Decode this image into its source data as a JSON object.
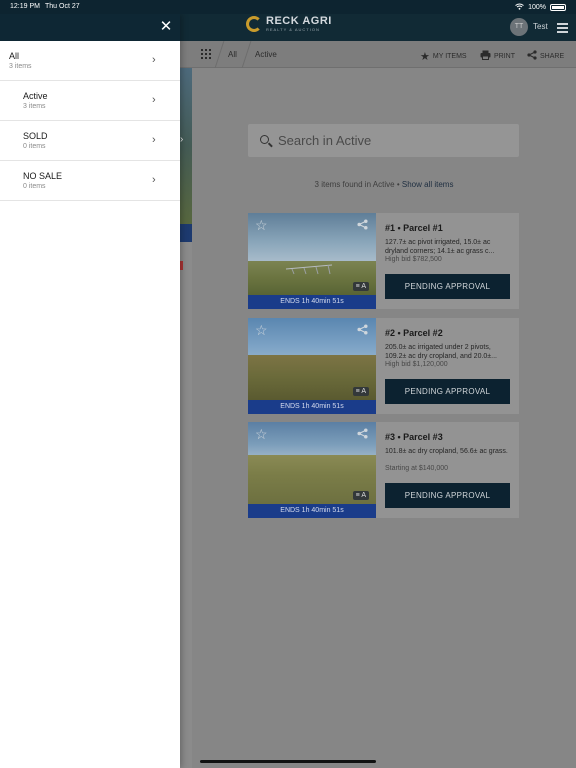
{
  "status_bar": {
    "time": "12:19 PM",
    "date": "Thu Oct 27",
    "battery": "100%"
  },
  "header": {
    "logo_name": "RECK AGRI",
    "logo_sub": "REALTY & AUCTION",
    "avatar_initials": "TT",
    "username": "Test"
  },
  "toolbar": {
    "breadcrumbs": [
      "All",
      "Active"
    ],
    "my_items": "MY ITEMS",
    "print": "PRINT",
    "share": "SHARE"
  },
  "search": {
    "placeholder": "Search in Active"
  },
  "results": {
    "summary": "3 items found in Active",
    "separator": "•",
    "show_all": "Show all items"
  },
  "lots": [
    {
      "title": "#1 • Parcel #1",
      "description": "127.7± ac pivot irrigated, 15.0± ac dryland corners; 14.1± ac grass c...",
      "bid": "High bid $782,500",
      "ends": "ENDS 1h 40min 51s",
      "badge": "A",
      "action": "PENDING APPROVAL"
    },
    {
      "title": "#2 • Parcel #2",
      "description": "205.0± ac irrigated under 2 pivots, 109.2± ac dry cropland, and 20.0±...",
      "bid": "High bid $1,120,000",
      "ends": "ENDS 1h 40min 51s",
      "badge": "A",
      "action": "PENDING APPROVAL"
    },
    {
      "title": "#3 • Parcel #3",
      "description": "101.8± ac dry cropland, 56.6± ac grass.",
      "bid": "Starting at $140,000",
      "ends": "ENDS 1h 40min 51s",
      "badge": "A",
      "action": "PENDING APPROVAL"
    }
  ],
  "drawer": {
    "items": [
      {
        "label": "All",
        "count": "3 items"
      },
      {
        "label": "Active",
        "count": "3 items"
      },
      {
        "label": "SOLD",
        "count": "0 items"
      },
      {
        "label": "NO SALE",
        "count": "0 items"
      }
    ]
  },
  "colors": {
    "header": "#112a35",
    "ends_bar": "#1a3c8a",
    "action": "#0c2230",
    "logo_accent": "#c89b2c"
  },
  "icons": [
    "close-icon",
    "chevron-right-icon",
    "grid-icon",
    "star-icon",
    "print-icon",
    "share-icon",
    "search-icon",
    "list-icon",
    "menu-icon",
    "wifi-icon",
    "battery-icon"
  ]
}
